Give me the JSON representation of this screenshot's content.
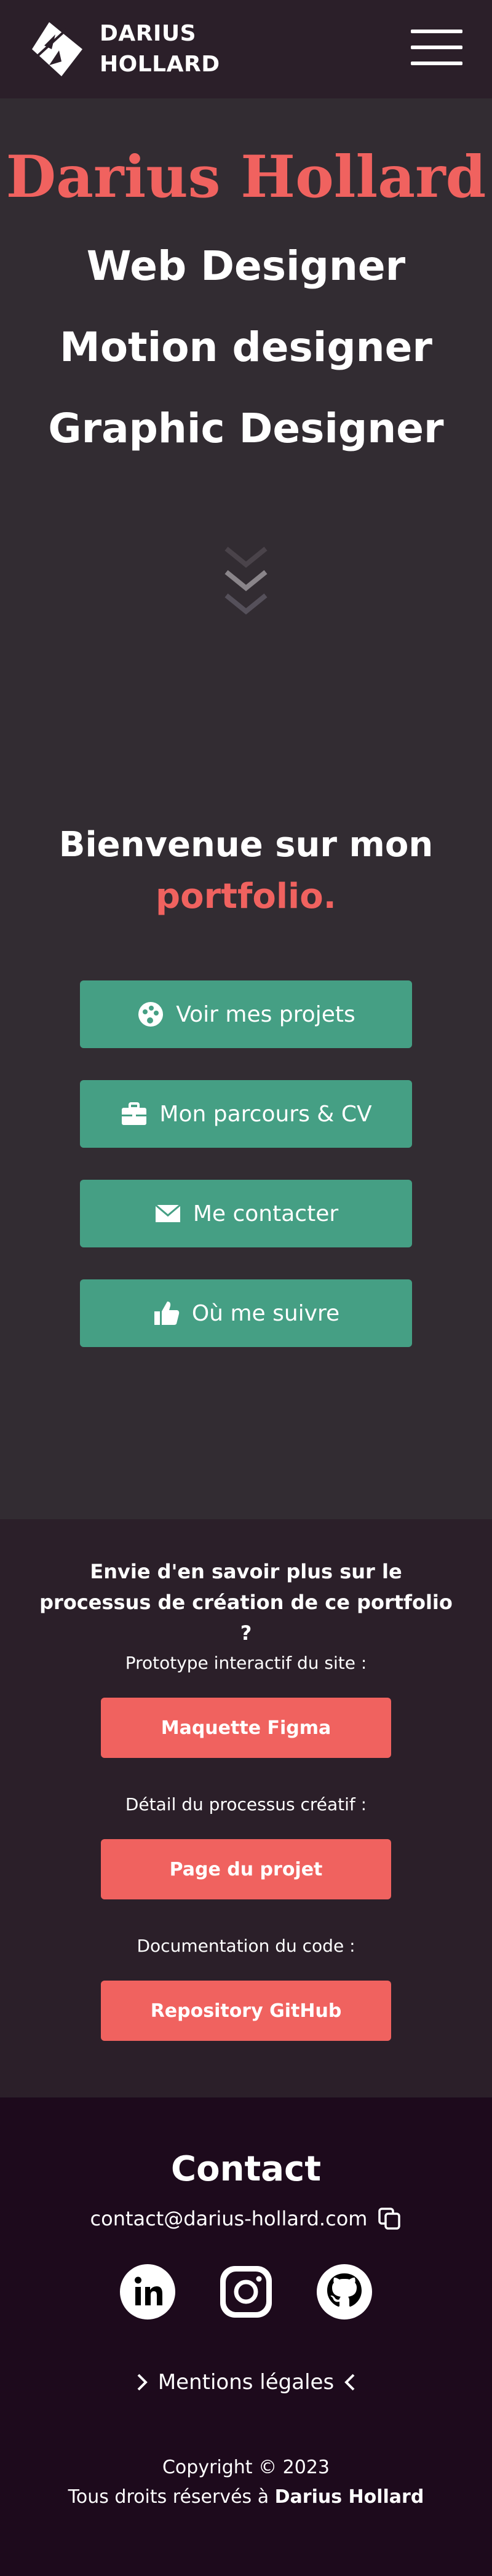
{
  "header": {
    "brand_line1": "DARIUS",
    "brand_line2": "HOLLARD",
    "menu_icon": "hamburger-menu-icon"
  },
  "hero": {
    "name": "Darius Hollard",
    "roles": [
      "Web Designer",
      "Motion designer",
      "Graphic Designer"
    ],
    "scroll_icon": "chevrons-down-icon",
    "welcome_line1": "Bienvenue sur mon",
    "welcome_accent": "portfolio.",
    "buttons": [
      {
        "label": "Voir mes projets",
        "icon": "palette-icon"
      },
      {
        "label": "Mon parcours & CV",
        "icon": "briefcase-icon"
      },
      {
        "label": "Me contacter",
        "icon": "envelope-icon"
      },
      {
        "label": "Où me suivre",
        "icon": "thumbs-up-icon"
      }
    ]
  },
  "process": {
    "title": "Envie d'en savoir plus sur le processus de création de ce portfolio ?",
    "items": [
      {
        "label": "Prototype interactif du site :",
        "button": "Maquette Figma"
      },
      {
        "label": "Détail du processus créatif :",
        "button": "Page du projet"
      },
      {
        "label": "Documentation du code :",
        "button": "Repository GitHub"
      }
    ]
  },
  "footer": {
    "contact_title": "Contact",
    "email": "contact@darius-hollard.com",
    "social": [
      "linkedin-icon",
      "instagram-icon",
      "github-icon"
    ],
    "legal": "Mentions légales",
    "copyright": "Copyright © 2023",
    "rights_prefix": "Tous droits réservés à ",
    "rights_name": "Darius Hollard"
  },
  "colors": {
    "header_bg": "#2b1f29",
    "hero_bg": "#322c32",
    "footer_bg": "#1d0a1c",
    "accent_red": "#f0625f",
    "accent_green": "#459f84"
  }
}
